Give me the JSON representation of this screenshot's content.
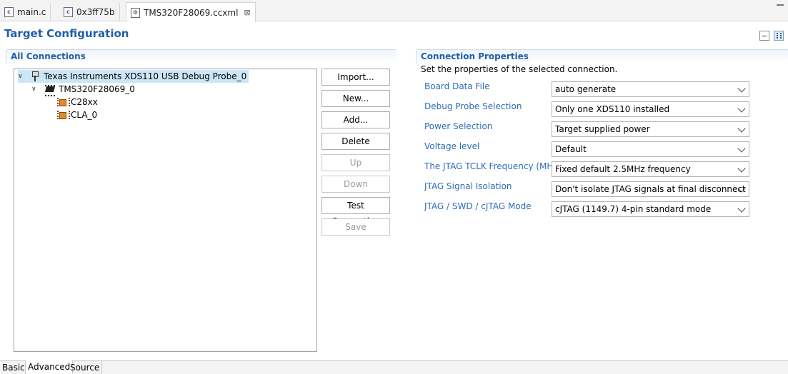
{
  "editor_tabs": [
    {
      "label": "main.c",
      "icon": "c-file-icon"
    },
    {
      "label": "0x3ff75b",
      "icon": "c-file-icon"
    },
    {
      "label": "TMS320F28069.ccxml",
      "icon": "config-file-icon",
      "close": "⊠"
    }
  ],
  "page": {
    "title": "Target Configuration"
  },
  "connections": {
    "header": "All Connections",
    "tree": [
      {
        "label": "Texas Instruments XDS110 USB Debug Probe_0",
        "icon": "probe-icon"
      },
      {
        "label": "TMS320F28069_0",
        "icon": "chip-icon"
      },
      {
        "label": "C28xx",
        "icon": "cpu-icon"
      },
      {
        "label": "CLA_0",
        "icon": "cpu-icon"
      }
    ]
  },
  "buttons": {
    "import": "Import...",
    "new": "New...",
    "add": "Add...",
    "delete": "Delete",
    "up": "Up",
    "down": "Down",
    "test": "Test Connection",
    "save": "Save"
  },
  "properties": {
    "header": "Connection Properties",
    "description": "Set the properties of the selected connection.",
    "rows": [
      {
        "label": "Board Data File",
        "value": "auto generate"
      },
      {
        "label": "Debug Probe Selection",
        "value": "Only one XDS110 installed"
      },
      {
        "label": "Power Selection",
        "value": "Target supplied power"
      },
      {
        "label": "Voltage level",
        "value": "Default"
      },
      {
        "label": "The JTAG TCLK Frequency (MHz)",
        "value": "Fixed default 2.5MHz frequency"
      },
      {
        "label": "JTAG Signal Isolation",
        "value": "Don't isolate JTAG signals at final disconnect"
      },
      {
        "label": "JTAG / SWD / cJTAG Mode",
        "value": "cJTAG (1149.7) 4-pin standard mode"
      }
    ]
  },
  "bottom_tabs": [
    "Basic",
    "Advanced",
    "Source"
  ],
  "colors": {
    "accent": "#1f5fa8",
    "label": "#2d6db5",
    "selection": "#cde6f7"
  }
}
